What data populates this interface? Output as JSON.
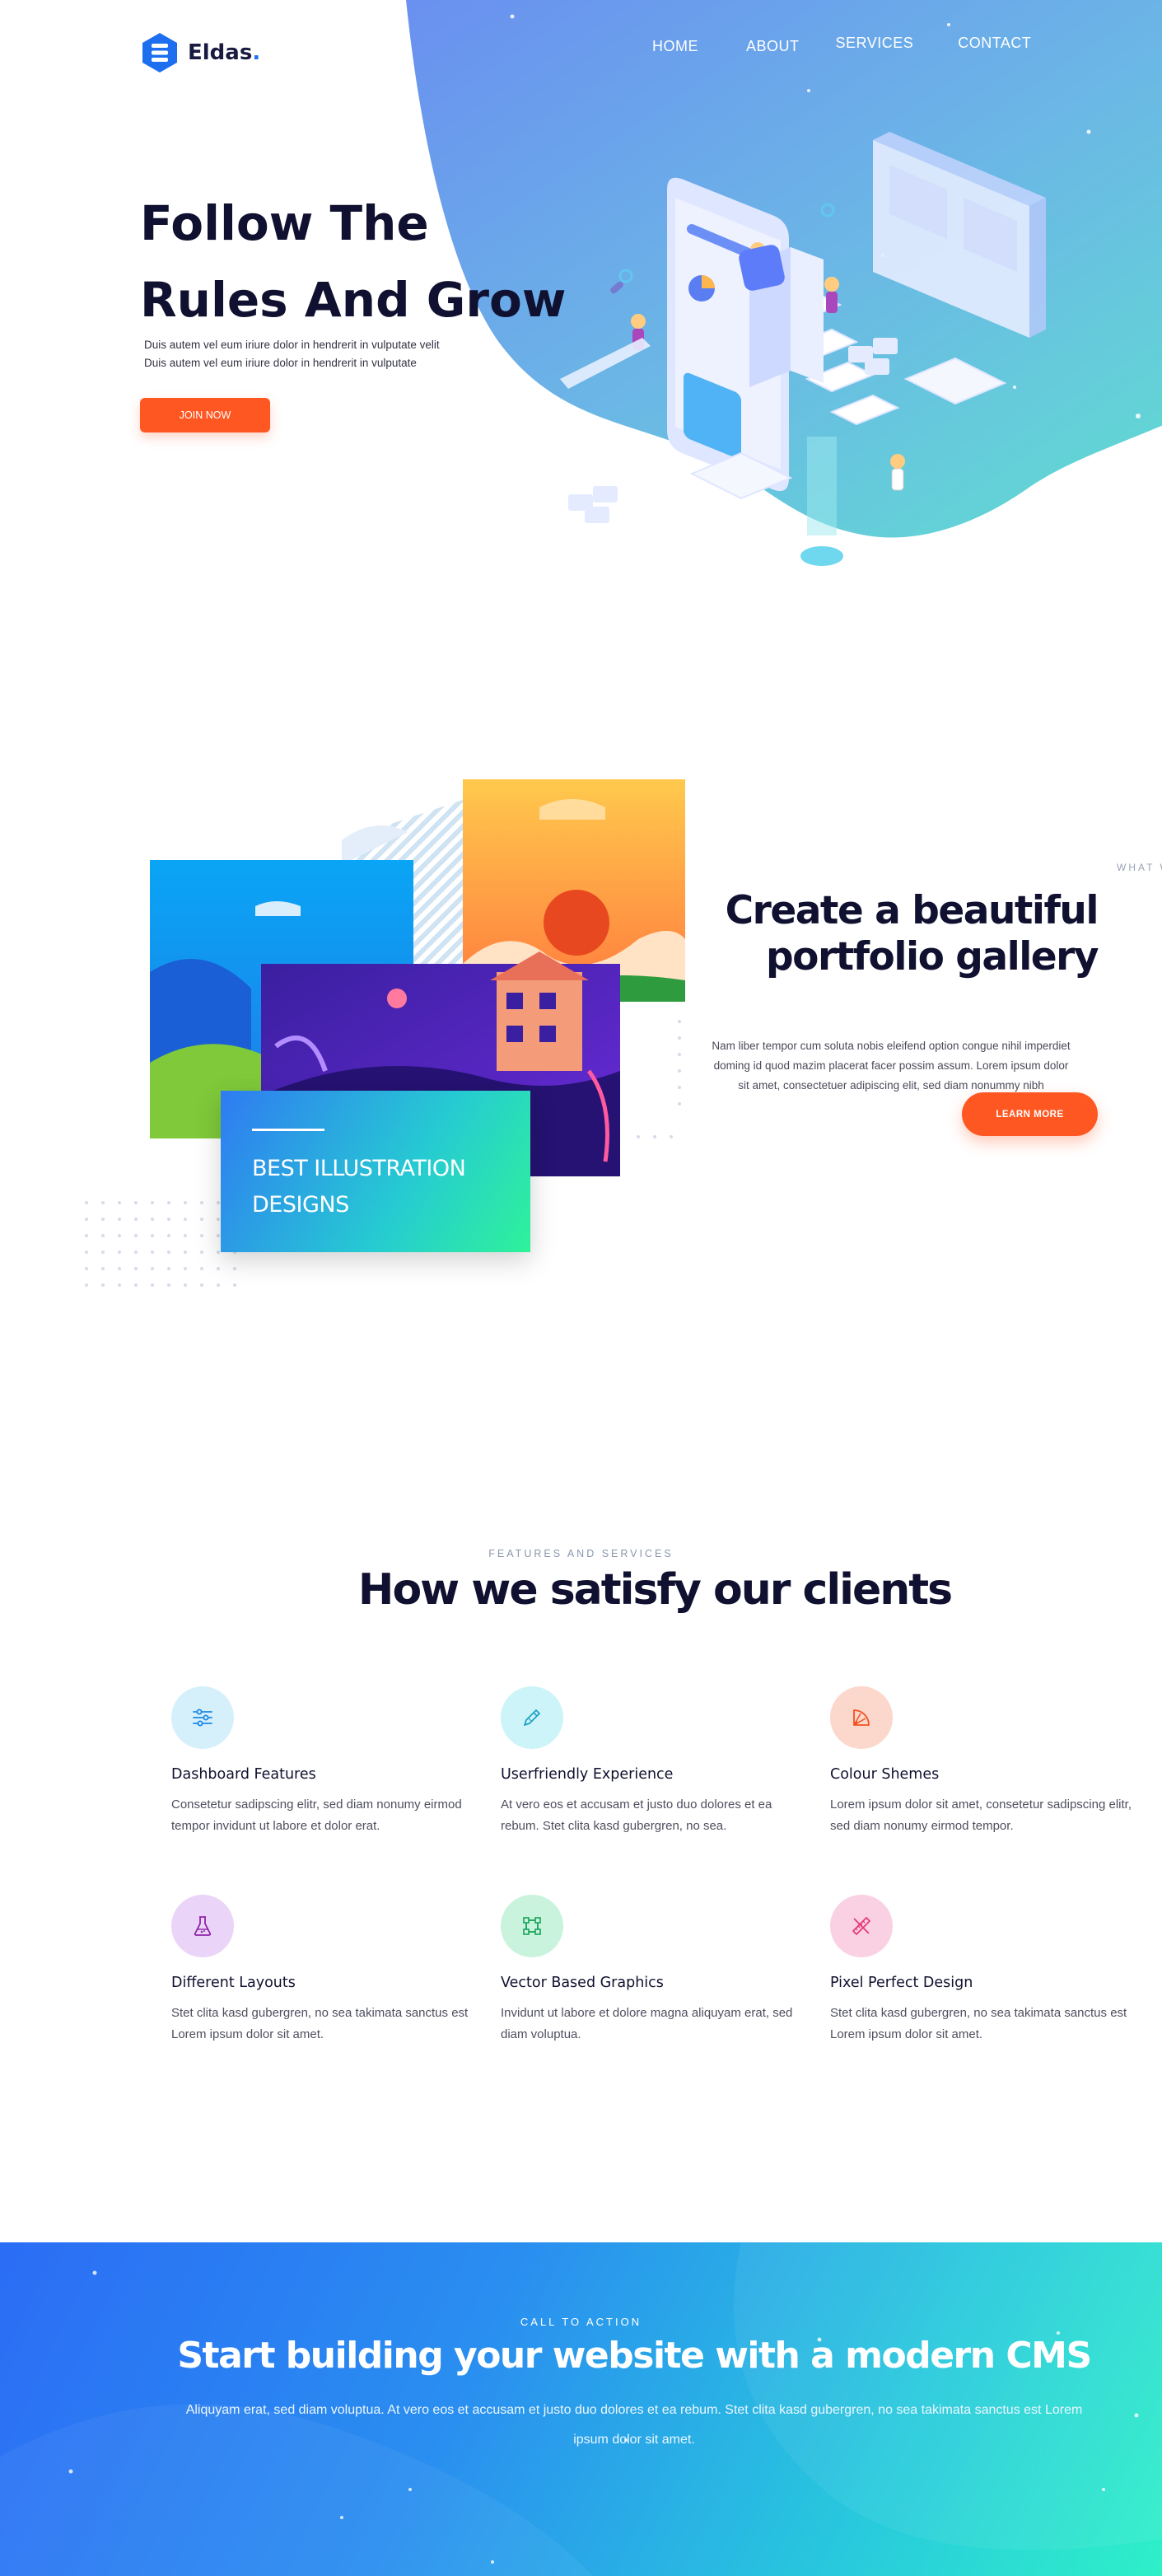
{
  "brand": {
    "name": "Eldas",
    "dot": "."
  },
  "nav": {
    "items": [
      "HOME",
      "ABOUT",
      "SERVICES",
      "CONTACT"
    ]
  },
  "hero": {
    "title_line1": "Follow The",
    "title_line2": "Rules And Grow",
    "sub_line1": "Duis autem vel eum iriure dolor in hendrerit in vulputate velit",
    "sub_line2": "Duis autem vel eum iriure dolor in hendrerit in vulputate",
    "cta_label": "JOIN NOW"
  },
  "portfolio": {
    "banner_line1": "BEST ILLUSTRATION",
    "banner_line2": "DESIGNS",
    "side_label": "WHAT W",
    "title_line1": "Create a beautiful",
    "title_line2": "portfolio gallery",
    "text": "Nam liber tempor cum soluta nobis eleifend option congue nihil imperdiet doming id quod mazim placerat facer possim assum. Lorem ipsum dolor sit amet, consectetuer adipiscing elit, sed diam nonummy nibh",
    "cta_label": "LEARN MORE"
  },
  "features": {
    "label": "FEATURES AND SERVICES",
    "title": "How we satisfy our clients",
    "items": [
      {
        "icon": "sliders-icon",
        "title": "Dashboard Features",
        "desc": "Consetetur sadipscing elitr, sed diam nonumy eirmod tempor invidunt ut labore et dolor erat.",
        "color": "#1e88e5",
        "bg": "#d6f0fb"
      },
      {
        "icon": "pencil-icon",
        "title": "Userfriendly Experience",
        "desc": "At vero eos et accusam et justo duo dolores et ea rebum. Stet clita kasd gubergren, no sea.",
        "color": "#1fa3c4",
        "bg": "#cdf4f8"
      },
      {
        "icon": "color-fan-icon",
        "title": "Colour Shemes",
        "desc": "Lorem ipsum dolor sit amet, consetetur sadipscing elitr, sed diam nonumy eirmod tempor.",
        "color": "#f4511e",
        "bg": "#fbd7cc"
      },
      {
        "icon": "flask-icon",
        "title": "Different Layouts",
        "desc": "Stet clita kasd gubergren, no sea takimata sanctus est Lorem ipsum dolor sit amet.",
        "color": "#8e24aa",
        "bg": "#ead4f7"
      },
      {
        "icon": "vector-icon",
        "title": "Vector Based Graphics",
        "desc": "Invidunt ut labore et dolore magna aliquyam erat, sed diam voluptua.",
        "color": "#17a35a",
        "bg": "#c9f3dc"
      },
      {
        "icon": "pencil-ruler-icon",
        "title": "Pixel Perfect Design",
        "desc": "Stet clita kasd gubergren, no sea takimata sanctus est Lorem ipsum dolor sit amet.",
        "color": "#e53978",
        "bg": "#fad1e2"
      }
    ]
  },
  "cta": {
    "label": "CALL TO ACTION",
    "title": "Start building your website with a modern CMS",
    "text": "Aliquyam erat, sed diam voluptua. At vero eos et accusam et justo duo dolores et ea rebum. Stet clita kasd gubergren, no sea takimata sanctus est Lorem ipsum dolor sit amet."
  },
  "colors": {
    "accent": "#ff5722",
    "dark": "#101030",
    "brand_blue": "#1e6ff0"
  }
}
